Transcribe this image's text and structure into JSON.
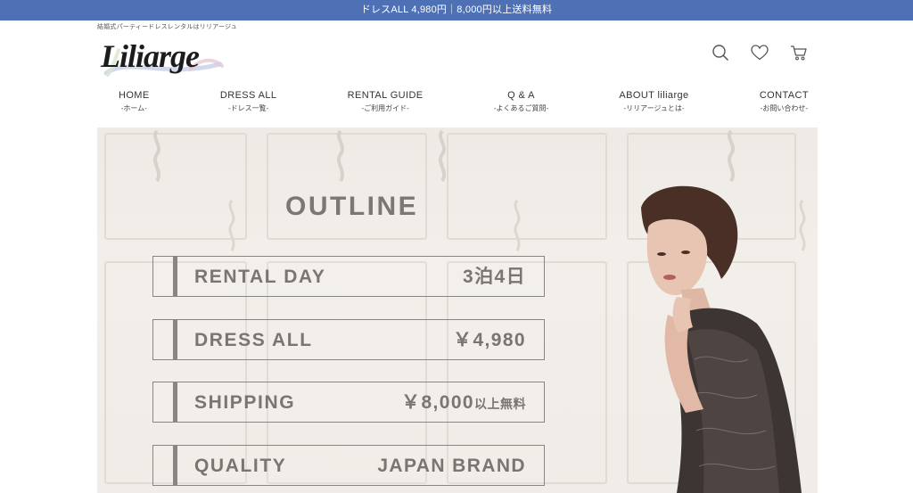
{
  "announcement": "ドレスALL 4,980円｜8,000円以上送料無料",
  "tagline": "結婚式パーティードレスレンタルはリリアージュ",
  "logo": {
    "text": "Liliarge"
  },
  "header_icons": [
    "search-icon",
    "heart-icon",
    "cart-icon"
  ],
  "nav": [
    {
      "en": "HOME",
      "jp": "-ホーム-"
    },
    {
      "en": "DRESS ALL",
      "jp": "-ドレス一覧-"
    },
    {
      "en": "RENTAL GUIDE",
      "jp": "-ご利用ガイド-"
    },
    {
      "en": "Q & A",
      "jp": "-よくあるご質問-"
    },
    {
      "en": "ABOUT liliarge",
      "jp": "-リリアージュとは-"
    },
    {
      "en": "CONTACT",
      "jp": "-お問い合わせ-"
    }
  ],
  "hero": {
    "title": "OUTLINE",
    "rows": [
      {
        "label": "RENTAL DAY",
        "value": "3泊4日",
        "suffix": ""
      },
      {
        "label": "DRESS ALL",
        "value": "￥4,980",
        "suffix": ""
      },
      {
        "label": "SHIPPING",
        "value": "￥8,000",
        "suffix": "以上無料"
      },
      {
        "label": "QUALITY",
        "value": "JAPAN BRAND",
        "suffix": ""
      }
    ]
  },
  "colors": {
    "announcement_bg": "#4e71b5",
    "hero_text": "#7a7472",
    "hero_bg": "#eeeae5"
  }
}
